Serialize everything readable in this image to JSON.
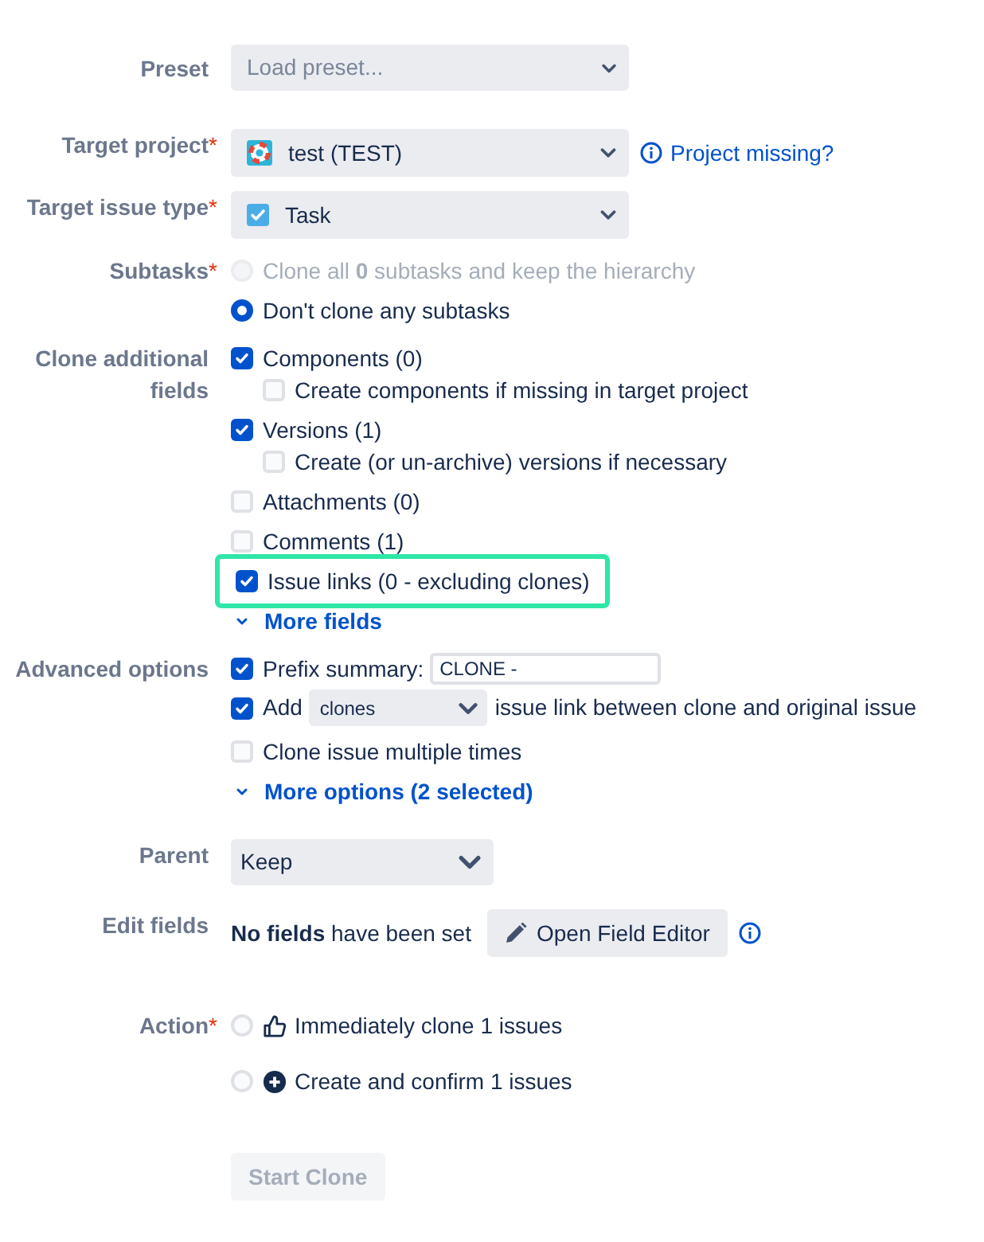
{
  "preset": {
    "label": "Preset",
    "placeholder": "Load preset..."
  },
  "target_project": {
    "label": "Target project",
    "required_mark": "*",
    "value": "test (TEST)",
    "link": "Project missing?"
  },
  "target_issue_type": {
    "label": "Target issue type",
    "required_mark": "*",
    "value": "Task"
  },
  "subtasks": {
    "label": "Subtasks",
    "required_mark": "*",
    "options": [
      {
        "text": "Clone all **0** subtasks and keep the hierarchy",
        "selected": false,
        "disabled": true
      },
      {
        "text": "Don't clone any subtasks",
        "selected": true,
        "disabled": false
      }
    ]
  },
  "clone_fields": {
    "label": "Clone additional fields",
    "items": [
      {
        "label": "Components (0)",
        "checked": true,
        "highlighted": false,
        "children": [
          {
            "label": "Create components if missing in target project",
            "checked": false
          }
        ]
      },
      {
        "label": "Versions (1)",
        "checked": true,
        "highlighted": false,
        "children": [
          {
            "label": "Create (or un-archive) versions if necessary",
            "checked": false
          }
        ]
      },
      {
        "label": "Attachments (0)",
        "checked": false,
        "highlighted": false
      },
      {
        "label": "Comments (1)",
        "checked": false,
        "highlighted": false
      },
      {
        "label": "Issue links (0 - excluding clones)",
        "checked": true,
        "highlighted": true
      }
    ],
    "more_link": "More fields"
  },
  "advanced_options": {
    "label": "Advanced options",
    "items": [
      {
        "kind": "prefix",
        "label": "Prefix summary:",
        "checked": true,
        "value": "CLONE -"
      },
      {
        "kind": "link",
        "label": "Add",
        "checked": true,
        "value": "clones",
        "suffix": "issue link between clone and original issue"
      },
      {
        "kind": "plain",
        "label": "Clone issue multiple times",
        "checked": false
      }
    ],
    "more_link": "More options (2 selected)"
  },
  "parent": {
    "label": "Parent",
    "value": "Keep"
  },
  "edit_fields": {
    "label": "Edit fields",
    "text": "**No fields** have been set",
    "button": "Open Field Editor"
  },
  "action": {
    "label": "Action",
    "required_mark": "*",
    "options": [
      {
        "kind": "thumbs",
        "text": "Immediately clone 1 issues",
        "selected": false
      },
      {
        "kind": "plus",
        "text": "Create and confirm 1 issues",
        "selected": false
      }
    ]
  },
  "start_button": {
    "label": "Start Clone",
    "disabled": true
  }
}
